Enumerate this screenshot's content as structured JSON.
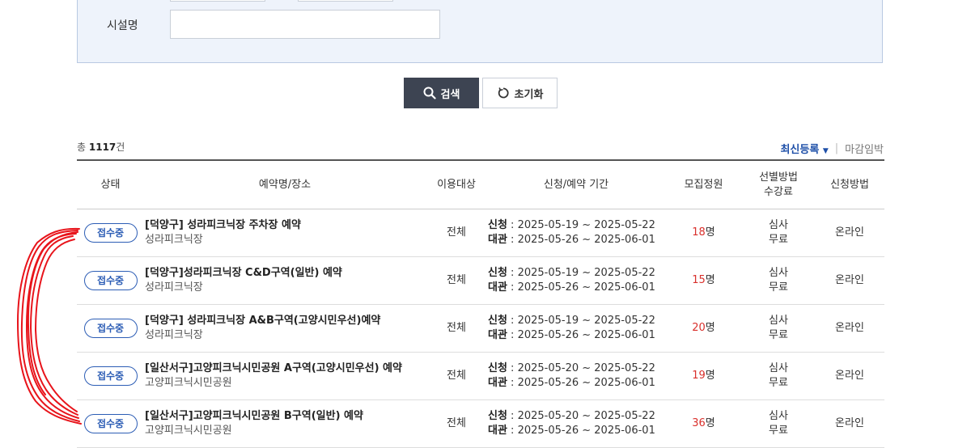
{
  "search": {
    "facility_label": "시설명",
    "facility_value": "",
    "search_button": "검색",
    "reset_button": "초기화"
  },
  "summary": {
    "total_prefix": "총",
    "total_count": "1117",
    "total_suffix": "건"
  },
  "sort": {
    "active": "최신등록",
    "other": "마감임박"
  },
  "table": {
    "headers": {
      "status": "상태",
      "name": "예약명/장소",
      "target": "이용대상",
      "period": "신청/예약 기간",
      "capacity": "모집정원",
      "selection_line1": "선별방법",
      "selection_line2": "수강료",
      "method": "신청방법"
    },
    "apply_label": "신청",
    "use_label": "대관",
    "rows": [
      {
        "status": "접수중",
        "title": "[덕양구] 성라피크닉장 주차장 예약",
        "place": "성라피크닉장",
        "target": "전체",
        "apply": "2025-05-19 ~ 2025-05-22",
        "use": "2025-05-26 ~ 2025-06-01",
        "count": "18",
        "unit": "명",
        "selection": "심사",
        "fee": "무료",
        "method": "온라인"
      },
      {
        "status": "접수중",
        "title": "[덕양구]성라피크닉장 C&D구역(일반) 예약",
        "place": "성라피크닉장",
        "target": "전체",
        "apply": "2025-05-19 ~ 2025-05-22",
        "use": "2025-05-26 ~ 2025-06-01",
        "count": "15",
        "unit": "명",
        "selection": "심사",
        "fee": "무료",
        "method": "온라인"
      },
      {
        "status": "접수중",
        "title": "[덕양구] 성라피크닉장 A&B구역(고양시민우선)예약",
        "place": "성라피크닉장",
        "target": "전체",
        "apply": "2025-05-19 ~ 2025-05-22",
        "use": "2025-05-26 ~ 2025-06-01",
        "count": "20",
        "unit": "명",
        "selection": "심사",
        "fee": "무료",
        "method": "온라인"
      },
      {
        "status": "접수중",
        "title": "[일산서구]고양피크닉시민공원 A구역(고양시민우선) 예약",
        "place": "고양피크닉시민공원",
        "target": "전체",
        "apply": "2025-05-20 ~ 2025-05-22",
        "use": "2025-05-26 ~ 2025-06-01",
        "count": "19",
        "unit": "명",
        "selection": "심사",
        "fee": "무료",
        "method": "온라인"
      },
      {
        "status": "접수중",
        "title": "[일산서구]고양피크닉시민공원 B구역(일반) 예약",
        "place": "고양피크닉시민공원",
        "target": "전체",
        "apply": "2025-05-20 ~ 2025-05-22",
        "use": "2025-05-26 ~ 2025-06-01",
        "count": "36",
        "unit": "명",
        "selection": "심사",
        "fee": "무료",
        "method": "온라인"
      }
    ]
  },
  "colors": {
    "accent": "#2c5db5",
    "count": "#d9302c",
    "annotation": "#e8141b"
  },
  "icons": {
    "search": "search-icon",
    "reset": "refresh-icon",
    "sort": "caret-down-icon"
  }
}
